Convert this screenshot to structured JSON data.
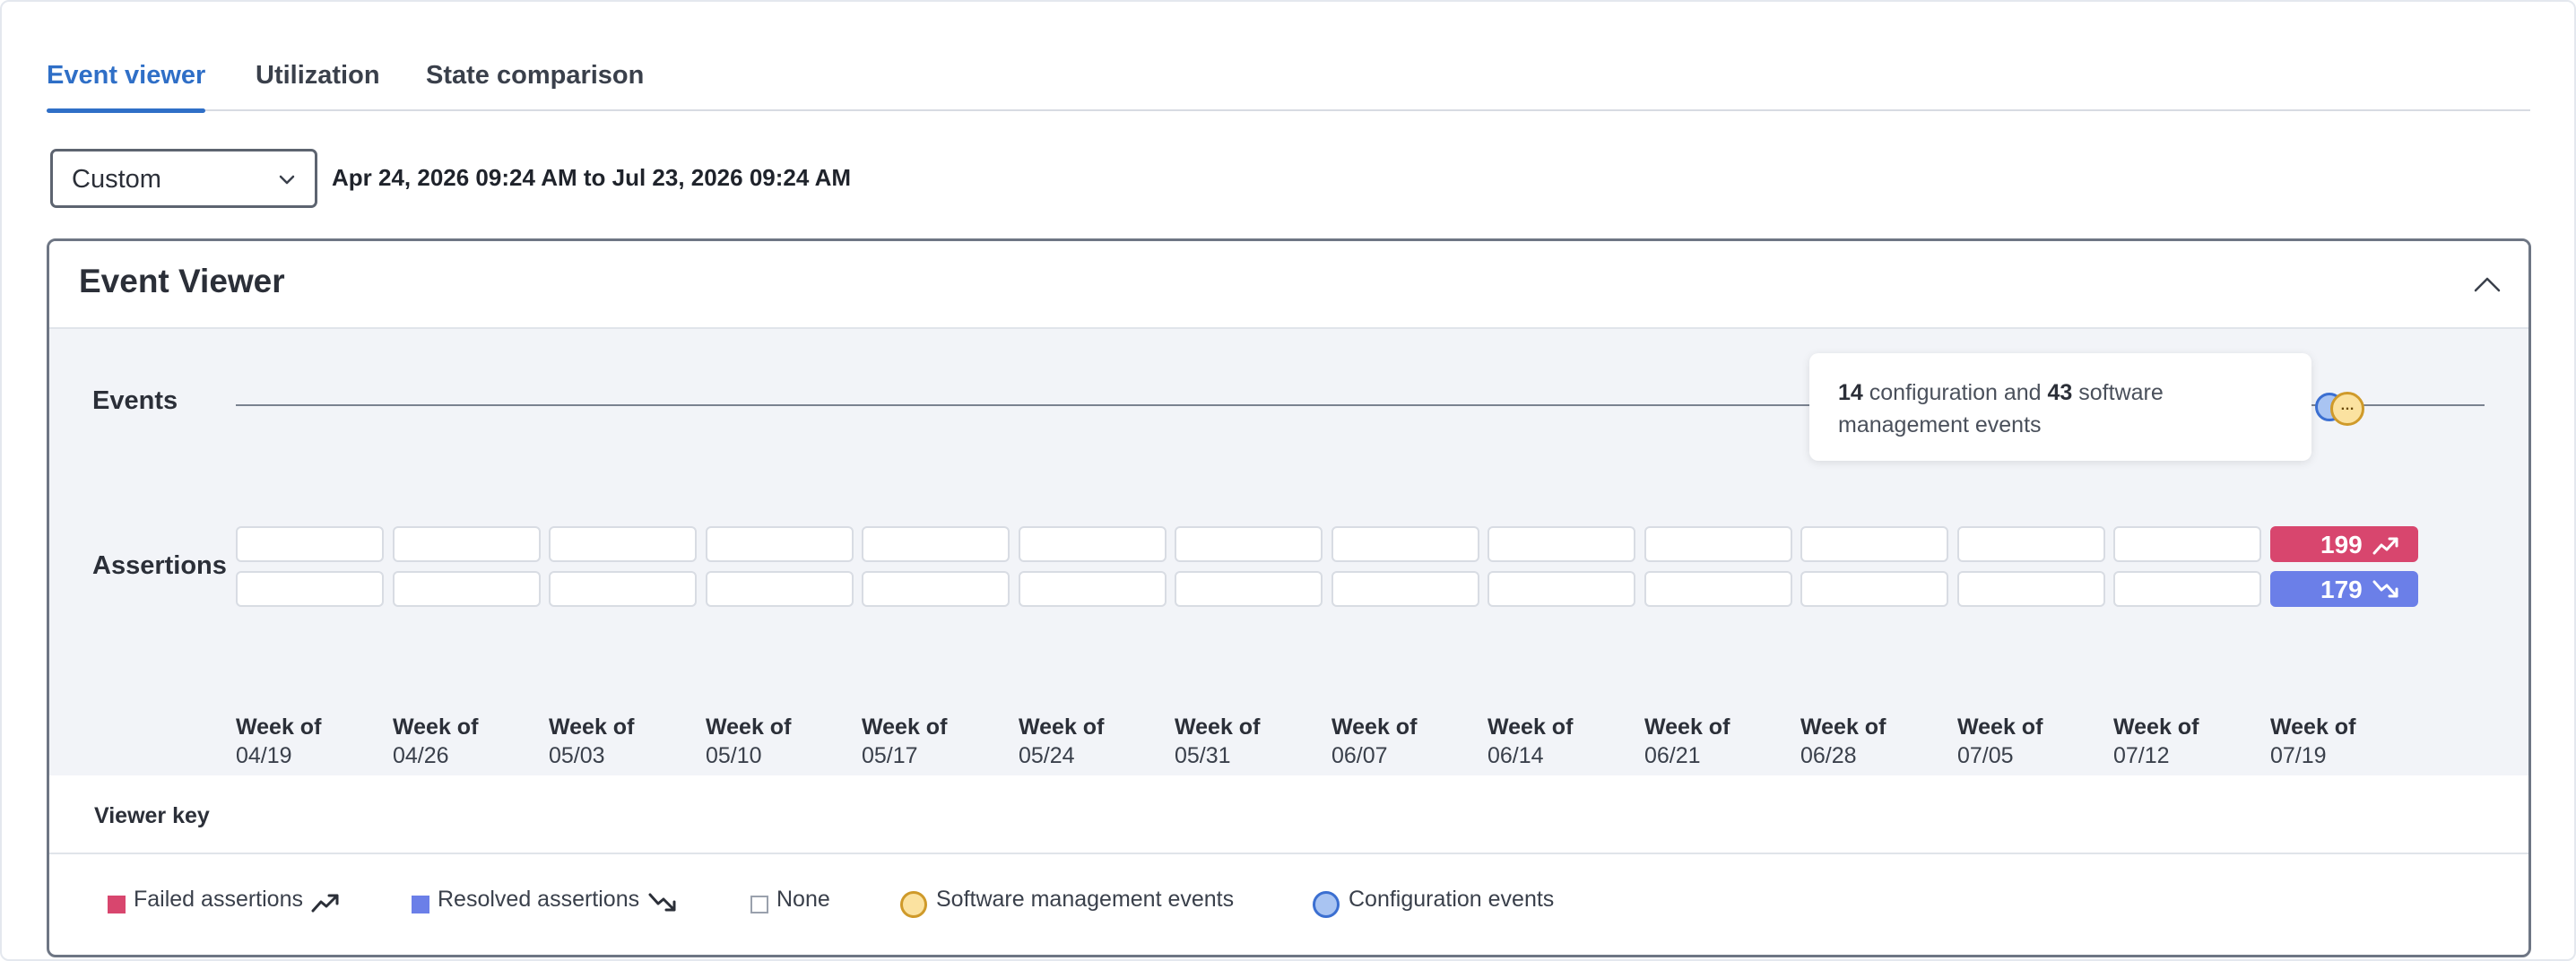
{
  "tabs": [
    {
      "label": "Event viewer",
      "active": true
    },
    {
      "label": "Utilization",
      "active": false
    },
    {
      "label": "State comparison",
      "active": false
    }
  ],
  "date_filter": {
    "selected": "Custom",
    "range_text": "Apr 24, 2026 09:24 AM to Jul 23, 2026 09:24 AM"
  },
  "panel": {
    "title": "Event Viewer",
    "rows": {
      "events": "Events",
      "assertions": "Assertions"
    },
    "tooltip": {
      "config_count": "14",
      "config_text": " configuration and ",
      "software_count": "43",
      "software_text": " software management events"
    },
    "event_marker_symbol": "…",
    "weeks": [
      {
        "line1": "Week of",
        "line2": "04/19"
      },
      {
        "line1": "Week of",
        "line2": "04/26"
      },
      {
        "line1": "Week of",
        "line2": "05/03"
      },
      {
        "line1": "Week of",
        "line2": "05/10"
      },
      {
        "line1": "Week of",
        "line2": "05/17"
      },
      {
        "line1": "Week of",
        "line2": "05/24"
      },
      {
        "line1": "Week of",
        "line2": "05/31"
      },
      {
        "line1": "Week of",
        "line2": "06/07"
      },
      {
        "line1": "Week of",
        "line2": "06/14"
      },
      {
        "line1": "Week of",
        "line2": "06/21"
      },
      {
        "line1": "Week of",
        "line2": "06/28"
      },
      {
        "line1": "Week of",
        "line2": "07/05"
      },
      {
        "line1": "Week of",
        "line2": "07/12"
      },
      {
        "line1": "Week of",
        "line2": "07/19"
      }
    ],
    "failed_assertions_last_week": "199",
    "resolved_assertions_last_week": "179"
  },
  "viewer_key": {
    "title": "Viewer key",
    "items": [
      {
        "label": "Failed assertions",
        "icon": "trend-up-icon"
      },
      {
        "label": "Resolved assertions",
        "icon": "trend-down-icon"
      },
      {
        "label": "None",
        "icon": "empty-square-icon"
      },
      {
        "label": "Software management events",
        "icon": "yellow-circle-icon"
      },
      {
        "label": "Configuration events",
        "icon": "blue-circle-icon"
      }
    ]
  },
  "colors": {
    "accent": "#2f6fc7",
    "failed": "#d8466e",
    "resolved": "#6b7fe8",
    "software_event_fill": "#fbe2a0",
    "software_event_border": "#cf9a2a",
    "config_event_fill": "#a9c4f2",
    "config_event_border": "#3b6fd1"
  }
}
